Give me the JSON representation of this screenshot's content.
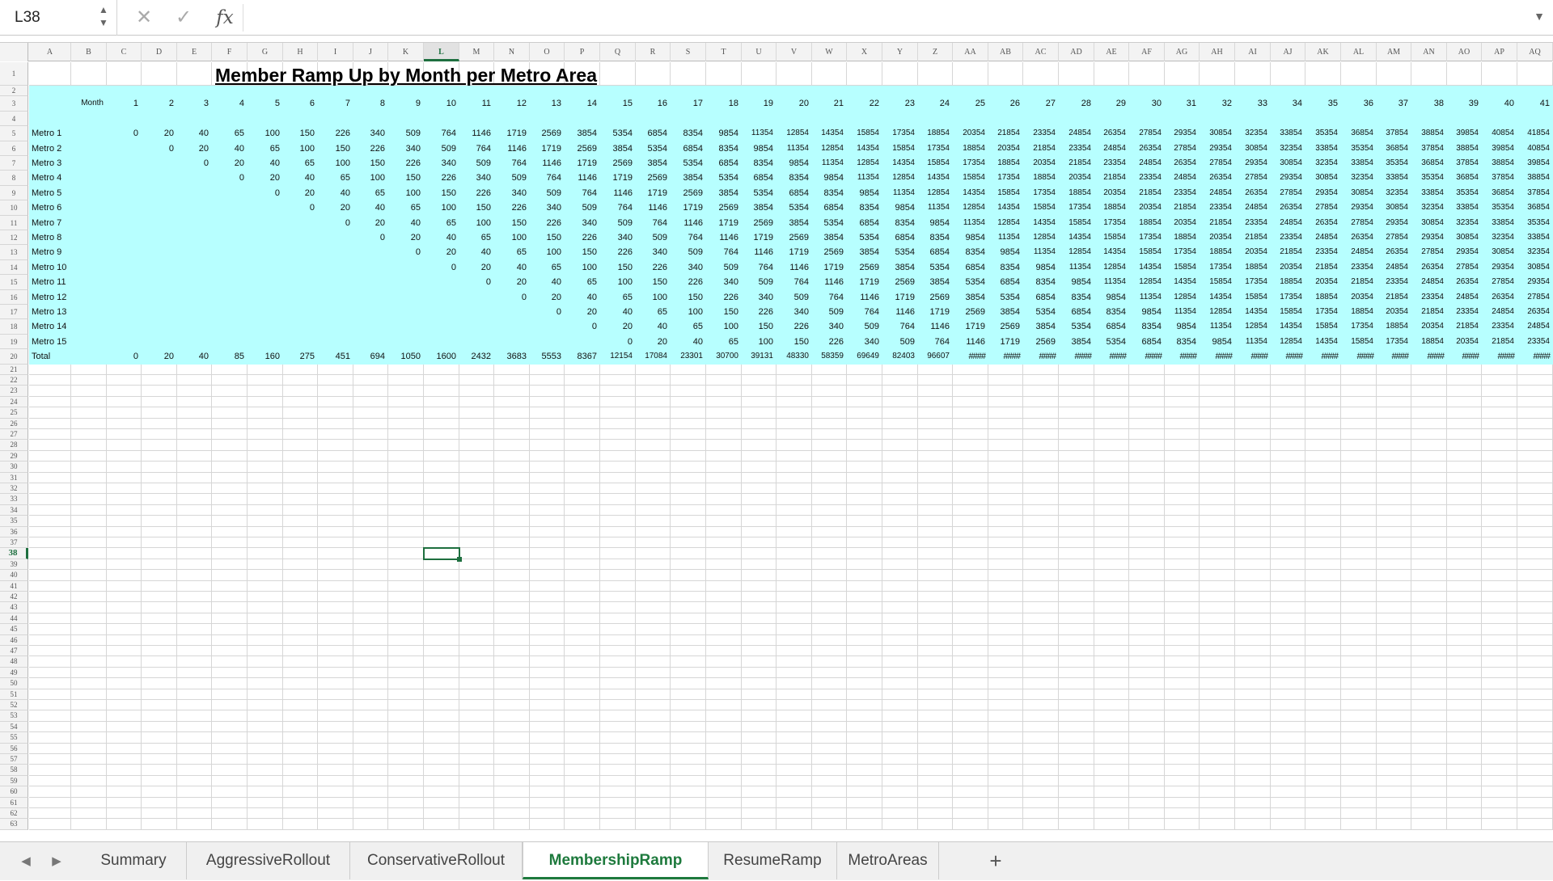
{
  "formula_bar": {
    "cell_ref": "L38",
    "fx": "fx",
    "formula": ""
  },
  "columns": [
    "A",
    "B",
    "C",
    "D",
    "E",
    "F",
    "G",
    "H",
    "I",
    "J",
    "K",
    "L",
    "M",
    "N",
    "O",
    "P",
    "Q",
    "R",
    "S",
    "T",
    "U",
    "V",
    "W",
    "X",
    "Y",
    "Z",
    "AA",
    "AB",
    "AC",
    "AD",
    "AE",
    "AF",
    "AG",
    "AH",
    "AI",
    "AJ",
    "AK",
    "AL",
    "AM",
    "AN",
    "AO",
    "AP",
    "AQ"
  ],
  "selected_column": "L",
  "selected_row": 38,
  "row_count": 63,
  "highlight_color": "#b7ffff",
  "sheet_title": "Member Ramp Up by Month per Metro Area",
  "month_label": "Month",
  "months": [
    1,
    2,
    3,
    4,
    5,
    6,
    7,
    8,
    9,
    10,
    11,
    12,
    13,
    14,
    15,
    16,
    17,
    18,
    19,
    20,
    21,
    22,
    23,
    24,
    25,
    26,
    27,
    28,
    29,
    30,
    31,
    32,
    33,
    34,
    35,
    36,
    37,
    38,
    39,
    40,
    41
  ],
  "ramp_sequence": [
    0,
    20,
    40,
    65,
    100,
    150,
    226,
    340,
    509,
    764,
    1146,
    1719,
    2569,
    3854,
    5354,
    6854,
    8354,
    9854,
    11354,
    12854,
    14354,
    15854,
    17354,
    18854,
    20354,
    21854,
    23354,
    24854,
    26354,
    27854,
    29354,
    30854,
    32354,
    33854,
    35354,
    36854,
    37854,
    38854,
    39854,
    40854,
    41854
  ],
  "metros": [
    "Metro 1",
    "Metro 2",
    "Metro 3",
    "Metro 4",
    "Metro 5",
    "Metro 6",
    "Metro 7",
    "Metro 8",
    "Metro 9",
    "Metro 10",
    "Metro 11",
    "Metro 12",
    "Metro 13",
    "Metro 14",
    "Metro 15"
  ],
  "total_label": "Total",
  "totals": [
    "0",
    "20",
    "40",
    "85",
    "160",
    "275",
    "451",
    "694",
    "1050",
    "1600",
    "2432",
    "3683",
    "5553",
    "8367",
    "12154",
    "17084",
    "23301",
    "30700",
    "39131",
    "48330",
    "58359",
    "69649",
    "82403",
    "96607",
    "####",
    "####",
    "####",
    "####",
    "####",
    "####",
    "####",
    "####",
    "####",
    "####",
    "####",
    "####",
    "####",
    "####",
    "####",
    "####",
    "####"
  ],
  "tabs": [
    "Summary",
    "AggressiveRollout",
    "ConservativeRollout",
    "MembershipRamp",
    "ResumeRamp",
    "MetroAreas"
  ],
  "active_tab": "MembershipRamp",
  "add_tab": "+"
}
